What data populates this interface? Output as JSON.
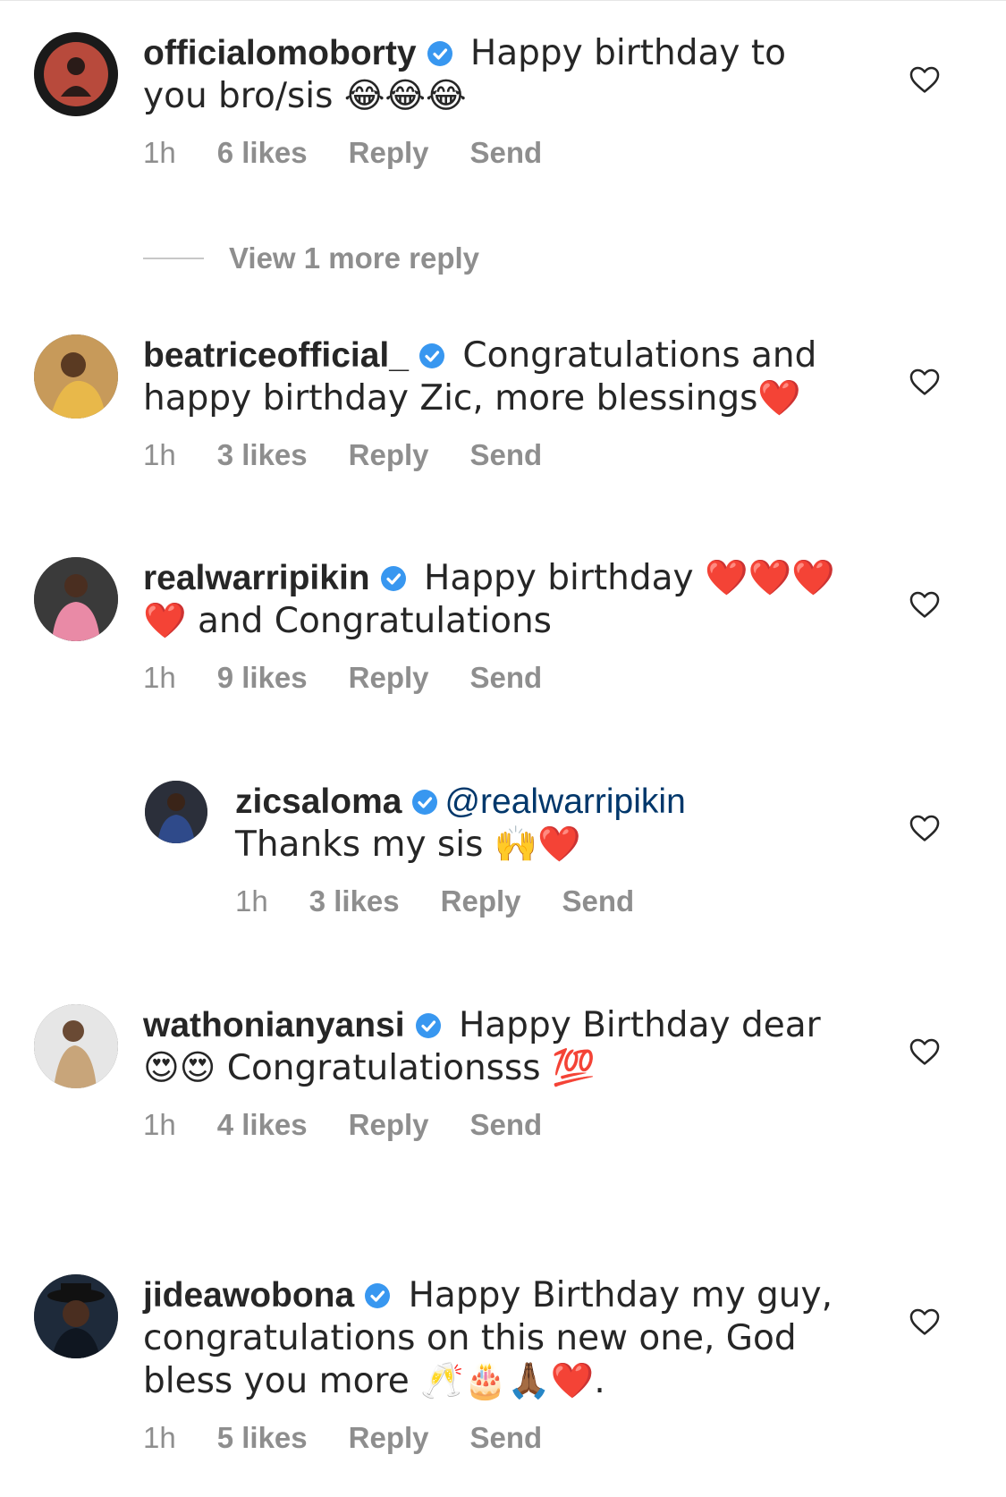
{
  "view_more": {
    "label": "View 1 more reply"
  },
  "comments": [
    {
      "username": "officialomoborty",
      "text": "Happy birthday to you bro/sis 😂😂😂",
      "time": "1h",
      "likes": "6 likes",
      "reply": "Reply",
      "send": "Send"
    },
    {
      "username": "beatriceofficial_",
      "text": "Congratulations and happy birthday Zic, more blessings❤️",
      "time": "1h",
      "likes": "3 likes",
      "reply": "Reply",
      "send": "Send"
    },
    {
      "username": "realwarripikin",
      "text": "Happy birthday ❤️❤️❤️❤️ and Congratulations",
      "time": "1h",
      "likes": "9 likes",
      "reply": "Reply",
      "send": "Send"
    },
    {
      "username": "zicsaloma",
      "mention": "@realwarripikin",
      "text": "Thanks my sis 🙌❤️",
      "time": "1h",
      "likes": "3 likes",
      "reply": "Reply",
      "send": "Send"
    },
    {
      "username": "wathonianyansi",
      "text": "Happy Birthday dear 😍😍 Congratulationsss 💯",
      "time": "1h",
      "likes": "4 likes",
      "reply": "Reply",
      "send": "Send"
    },
    {
      "username": "jideawobona",
      "text": "Happy Birthday my guy, congratulations on this new one, God bless you more 🥂🎂🙏🏾❤️.",
      "time": "1h",
      "likes": "5 likes",
      "reply": "Reply",
      "send": "Send"
    }
  ],
  "colors": {
    "verified": "#3897f0",
    "mention": "#00376b",
    "meta": "#8e8e8e"
  },
  "icons": {
    "verified": "verified-badge-icon",
    "like": "heart-outline-icon"
  }
}
